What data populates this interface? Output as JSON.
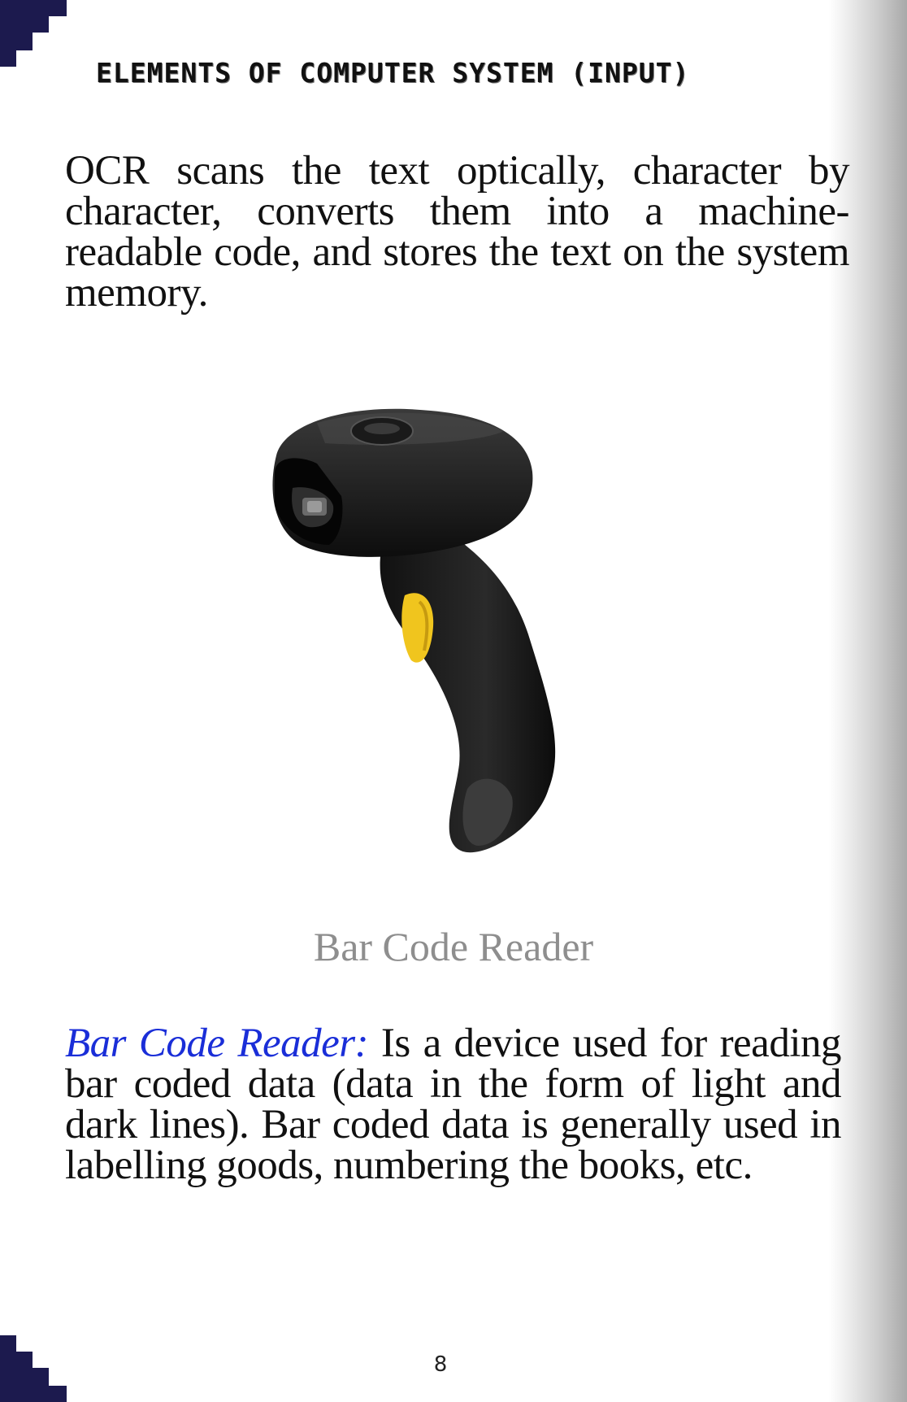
{
  "header": {
    "title": "ELEMENTS OF COMPUTER SYSTEM (INPUT)"
  },
  "paragraph1": "OCR scans the text optically, character by character, converts them into a machine-readable code, and stores the text on the system memory.",
  "figure": {
    "caption": "Bar Code Reader",
    "image_subject": "handheld-barcode-scanner"
  },
  "paragraph2": {
    "term": "Bar Code Reader:",
    "text": " Is a device used for reading bar coded data (data in the form of light and dark lines). Bar coded data is generally used in labelling goods, numbering the books, etc."
  },
  "page_number": "8",
  "colors": {
    "term": "#1a2ed8",
    "corner": "#1c1a4e",
    "caption": "#8e8e8e"
  }
}
